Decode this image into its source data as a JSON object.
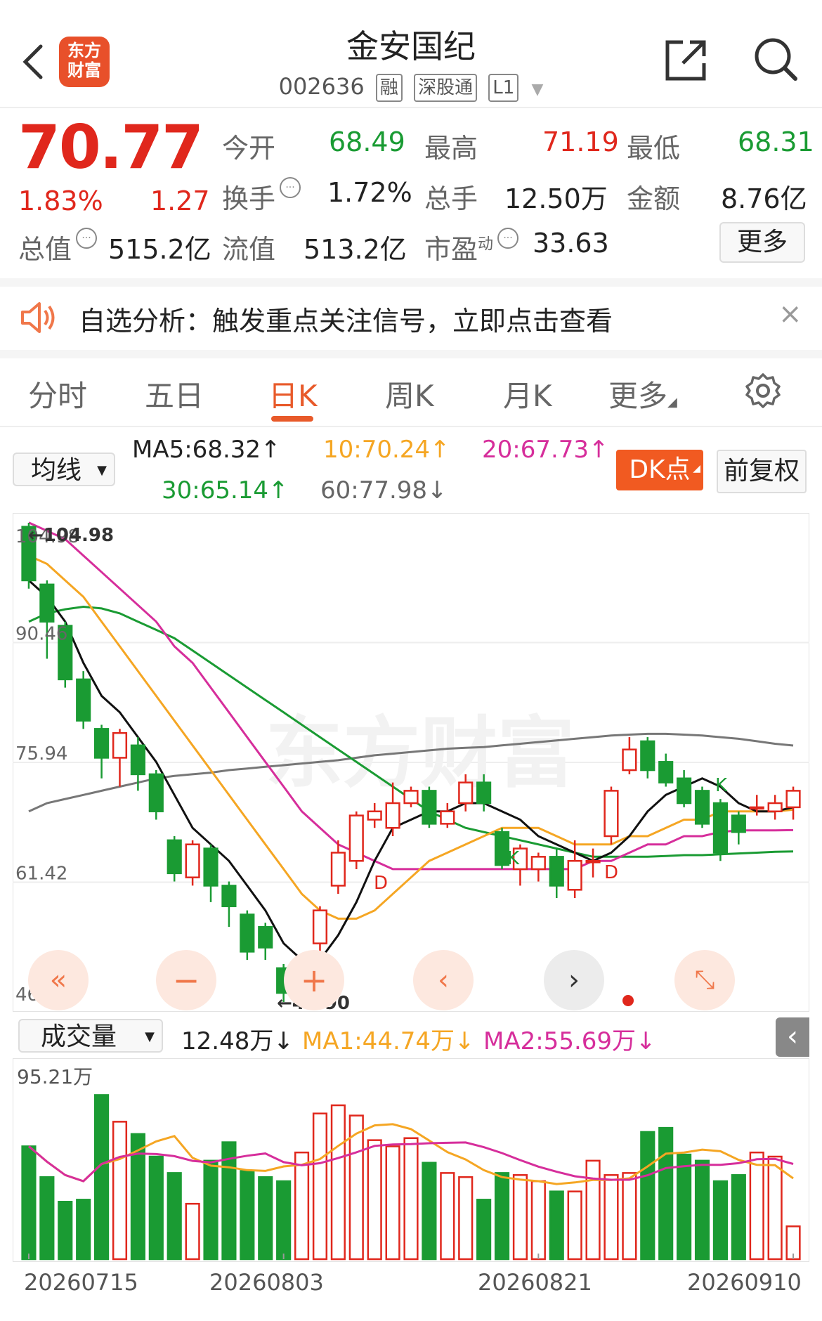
{
  "header": {
    "back_icon": "chevron-left-icon",
    "logo_text": [
      "东方",
      "财富"
    ],
    "title": "金安国纪",
    "code": "002636",
    "tags": [
      "融",
      "深股通",
      "L1"
    ],
    "share_icon": "share-icon",
    "search_icon": "search-icon"
  },
  "quote": {
    "price": "70.77",
    "change_pct": "1.83%",
    "change": "1.27",
    "open_label": "今开",
    "open": "68.49",
    "high_label": "最高",
    "high": "71.19",
    "low_label": "最低",
    "low": "68.31",
    "turnover_label": "换手",
    "turnover": "1.72%",
    "volume_label": "总手",
    "volume": "12.50万",
    "amount_label": "金额",
    "amount": "8.76亿",
    "mktcap_label": "总值",
    "mktcap": "515.2亿",
    "float_label": "流值",
    "float": "513.2亿",
    "pe_label": "市盈",
    "pe_sup": "动",
    "pe": "33.63",
    "more_label": "更多"
  },
  "notice": {
    "text": "自选分析：触发重点关注信号，立即点击查看",
    "close": "×"
  },
  "tabs": [
    "分时",
    "五日",
    "日K",
    "周K",
    "月K",
    "更多"
  ],
  "active_tab": "日K",
  "kline": {
    "ma_select": "均线",
    "ma5": "MA5:68.32↑",
    "ma10": "10:70.24↑",
    "ma20": "20:67.73↑",
    "ma30": "30:65.14↑",
    "ma60": "60:77.98↓",
    "dk_label": "DK点",
    "adjust_label": "前复权",
    "y_ticks": [
      "104.98",
      "90.46",
      "75.94",
      "61.42",
      "46.90"
    ],
    "max_label": "←104.98",
    "min_label": "←46.90",
    "watermark": "东方财富",
    "marks": [
      "D",
      "K",
      "D",
      "K"
    ]
  },
  "volume": {
    "select": "成交量",
    "vol": "12.48万↓",
    "ma1": "MA1:44.74万↓",
    "ma2": "MA2:55.69万↓",
    "top_label": "95.21万",
    "dates": [
      "20260715",
      "20260803",
      "20260821",
      "20260910"
    ]
  },
  "colors": {
    "up": "#e0271c",
    "down": "#1a9b33",
    "accent": "#f15a21"
  },
  "chart_data": {
    "type": "candlestick",
    "ylim": [
      46.9,
      104.98
    ],
    "candles": [
      [
        104.5,
        98.0,
        104.98,
        97.0
      ],
      [
        97.5,
        93.0,
        98.0,
        88.5
      ],
      [
        92.5,
        86.0,
        93.0,
        85.0
      ],
      [
        86.0,
        81.0,
        87.0,
        80.0
      ],
      [
        80.0,
        76.5,
        80.5,
        74.0
      ],
      [
        76.5,
        79.5,
        80.0,
        73.0
      ],
      [
        78.0,
        74.5,
        79.0,
        72.5
      ],
      [
        74.5,
        70.0,
        75.0,
        69.0
      ],
      [
        66.5,
        62.5,
        67.0,
        61.5
      ],
      [
        62.0,
        66.0,
        66.5,
        61.0
      ],
      [
        65.5,
        61.0,
        66.0,
        59.0
      ],
      [
        61.0,
        58.5,
        61.5,
        56.0
      ],
      [
        57.5,
        53.0,
        58.0,
        52.0
      ],
      [
        56.0,
        53.5,
        56.5,
        52.0
      ],
      [
        51.0,
        48.0,
        51.5,
        46.9
      ],
      [
        49.0,
        51.0,
        51.5,
        48.0
      ],
      [
        54.0,
        58.0,
        58.5,
        53.0
      ],
      [
        61.0,
        65.0,
        66.5,
        60.0
      ],
      [
        64.0,
        69.5,
        70.0,
        63.0
      ],
      [
        69.0,
        70.0,
        71.0,
        68.0
      ],
      [
        68.0,
        71.0,
        73.5,
        67.0
      ],
      [
        71.0,
        72.5,
        73.0,
        70.5
      ],
      [
        72.5,
        68.5,
        73.0,
        68.0
      ],
      [
        68.5,
        70.0,
        71.0,
        68.0
      ],
      [
        71.0,
        73.5,
        74.5,
        70.0
      ],
      [
        73.5,
        71.0,
        74.5,
        70.0
      ],
      [
        67.5,
        63.5,
        68.0,
        63.0
      ],
      [
        63.0,
        65.5,
        66.0,
        61.0
      ],
      [
        63.0,
        64.5,
        65.0,
        61.5
      ],
      [
        64.5,
        61.0,
        65.5,
        59.5
      ],
      [
        60.5,
        64.0,
        66.5,
        59.5
      ],
      [
        64.0,
        64.0,
        65.5,
        62.0
      ],
      [
        67.0,
        72.5,
        73.0,
        66.0
      ],
      [
        75.0,
        77.5,
        79.0,
        74.5
      ],
      [
        78.5,
        75.0,
        79.0,
        74.0
      ],
      [
        76.0,
        73.5,
        77.0,
        73.0
      ],
      [
        74.0,
        71.0,
        75.0,
        70.5
      ],
      [
        72.5,
        68.5,
        73.0,
        68.0
      ],
      [
        71.0,
        65.0,
        71.5,
        64.0
      ],
      [
        69.5,
        67.5,
        70.0,
        66.0
      ],
      [
        70.5,
        70.5,
        72.0,
        69.5
      ],
      [
        70.0,
        71.0,
        72.0,
        69.0
      ],
      [
        70.5,
        72.5,
        73.0,
        69.0
      ]
    ],
    "ma5": [
      98,
      96,
      93,
      88,
      84,
      82,
      79,
      76,
      72,
      68,
      66,
      64,
      61,
      58,
      54,
      52,
      52,
      55,
      59,
      64,
      68,
      69,
      70,
      70,
      71,
      71,
      70,
      69,
      67,
      66,
      65,
      64,
      65,
      67,
      70,
      72,
      73,
      74,
      73,
      71,
      70,
      70,
      70.5
    ],
    "ma10": [
      101,
      100,
      98,
      96,
      93,
      90,
      87,
      84,
      81,
      78,
      75,
      72,
      69,
      66,
      63,
      60,
      58,
      57,
      57,
      58,
      60,
      62,
      64,
      65,
      66,
      67,
      68,
      68,
      68,
      67,
      66,
      66,
      66,
      67,
      67,
      68,
      69,
      69,
      70,
      70,
      70,
      70,
      70.2
    ],
    "ma20": [
      105,
      104,
      103,
      101,
      99,
      97,
      95,
      93,
      90,
      88,
      85,
      82,
      79,
      76,
      73,
      70,
      68,
      66,
      65,
      64,
      63,
      63,
      63,
      63,
      63,
      63,
      63,
      63,
      63,
      63,
      63,
      64,
      64,
      65,
      66,
      66,
      67,
      67,
      67.5,
      67.7,
      67.7,
      67.7,
      67.73
    ],
    "ma30": [
      93,
      94,
      94.5,
      94.8,
      94.6,
      94,
      93,
      92,
      91,
      89.5,
      88,
      86.5,
      85,
      83.5,
      82,
      80.5,
      79,
      77.5,
      76,
      74.5,
      73,
      71.5,
      70,
      69,
      68,
      67.5,
      67,
      66.5,
      66,
      65.5,
      65,
      64.5,
      64.5,
      64.5,
      64.5,
      64.6,
      64.7,
      64.7,
      64.8,
      64.9,
      65,
      65.1,
      65.14
    ],
    "ma60": [
      70,
      71,
      71.5,
      72,
      72.5,
      73,
      73.5,
      74,
      74.3,
      74.5,
      74.7,
      75,
      75.2,
      75.4,
      75.6,
      75.8,
      76,
      76.2,
      76.5,
      76.8,
      77,
      77.2,
      77.4,
      77.6,
      77.7,
      77.8,
      78,
      78.2,
      78.4,
      78.6,
      78.8,
      79,
      79.2,
      79.3,
      79.4,
      79.4,
      79.3,
      79.2,
      79,
      78.8,
      78.5,
      78.2,
      77.98
    ],
    "volumes": [
      55,
      40,
      28,
      29,
      80,
      67,
      61,
      50,
      42,
      27,
      48,
      57,
      43,
      40,
      38,
      52,
      71,
      75,
      70,
      58,
      55,
      59,
      47,
      42,
      40,
      29,
      42,
      41,
      38,
      33,
      33,
      48,
      41,
      42,
      62,
      64,
      51,
      48,
      38,
      41,
      52,
      50,
      16
    ],
    "volume_ylim": [
      0,
      95.21
    ]
  }
}
